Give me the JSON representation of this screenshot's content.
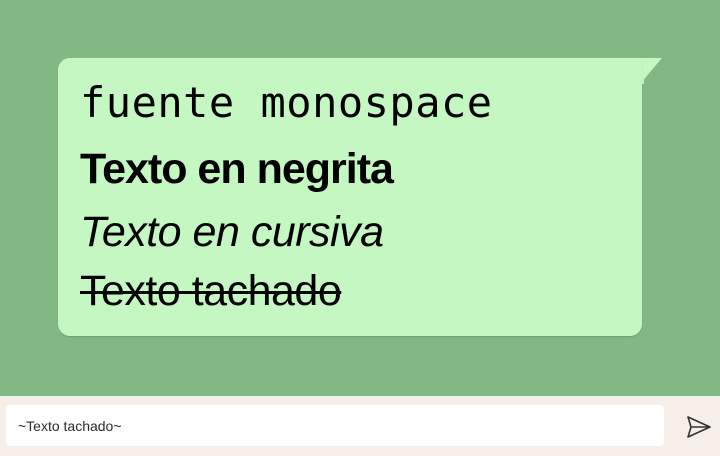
{
  "message": {
    "lines": [
      {
        "style": "monospace",
        "text": "fuente monospace"
      },
      {
        "style": "bold",
        "text": "Texto en negrita"
      },
      {
        "style": "italic",
        "text": "Texto en cursiva"
      },
      {
        "style": "strikethrough",
        "text": "Texto tachado"
      }
    ]
  },
  "composer": {
    "input_value": "~Texto tachado~",
    "send_icon": "send-icon"
  },
  "colors": {
    "chat_background": "#82b884",
    "bubble": "#c5f7c3",
    "composer_background": "#f5eee9"
  }
}
